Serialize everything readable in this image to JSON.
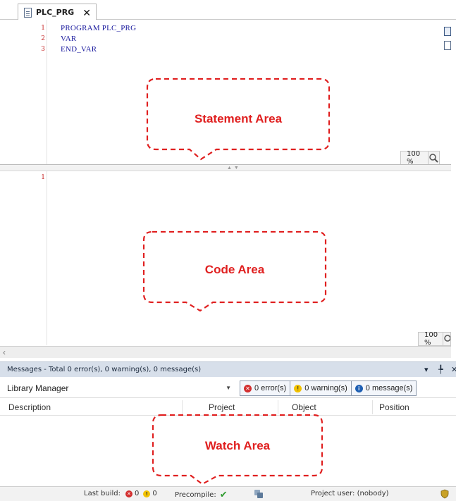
{
  "editor": {
    "tab_label": "PLC_PRG",
    "tab_close": "✕",
    "statement": {
      "lines": [
        {
          "num": "1",
          "text": "PROGRAM PLC_PRG"
        },
        {
          "num": "2",
          "text": "VAR"
        },
        {
          "num": "3",
          "text": "END_VAR"
        }
      ],
      "zoom": "100 %"
    },
    "code": {
      "lines": [
        {
          "num": "1",
          "text": ""
        }
      ],
      "zoom": "100 %"
    }
  },
  "callouts": {
    "statement": "Statement Area",
    "code": "Code Area",
    "watch": "Watch Area"
  },
  "messages": {
    "title": "Messages - Total 0 error(s), 0 warning(s), 0 message(s)",
    "pin": "▾  ╄  ✕",
    "source": "Library Manager",
    "filters": {
      "errors": "0 error(s)",
      "warnings": "0 warning(s)",
      "messages": "0 message(s)"
    },
    "columns": [
      "Description",
      "Project",
      "Object",
      "Position"
    ]
  },
  "statusbar": {
    "last_build_label": "Last build:",
    "errors_count": "0",
    "warnings_count": "0",
    "precompile_label": "Precompile:",
    "precompile_ok": "✔",
    "project_user": "Project user: (nobody)"
  },
  "colors": {
    "callout": "#e02020",
    "error": "#d32f2f",
    "warning": "#f2c200",
    "info": "#1e5fb3",
    "ok": "#2e9b2e"
  }
}
